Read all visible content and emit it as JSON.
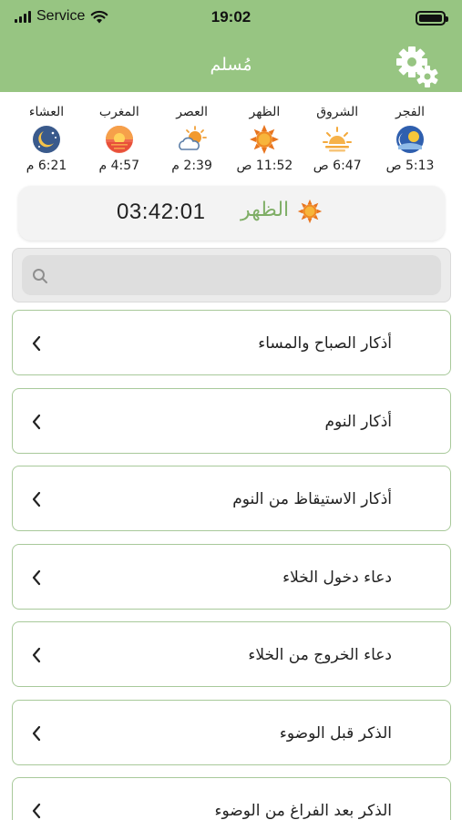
{
  "status_bar": {
    "carrier": "Service",
    "time": "19:02"
  },
  "header": {
    "title": "مُسلم",
    "settings_icon": "gear-icon",
    "background_color": "#97c582"
  },
  "prayers": [
    {
      "name": "الفجر",
      "time": "5:13 ص",
      "icon": "moon-sun-icon"
    },
    {
      "name": "الشروق",
      "time": "6:47 ص",
      "icon": "sunrise-icon"
    },
    {
      "name": "الظهر",
      "time": "11:52 ص",
      "icon": "sun-icon"
    },
    {
      "name": "العصر",
      "time": "2:39 م",
      "icon": "sun-cloud-icon"
    },
    {
      "name": "المغرب",
      "time": "4:57 م",
      "icon": "sunset-icon"
    },
    {
      "name": "العشاء",
      "time": "6:21 م",
      "icon": "moon-night-icon"
    }
  ],
  "next_prayer": {
    "name": "الظهر",
    "countdown": "03:42:01",
    "icon": "sun-icon",
    "accent_color": "#7fae66"
  },
  "search": {
    "placeholder": "",
    "value": ""
  },
  "list": {
    "items": [
      {
        "label": "أذكار الصباح والمساء"
      },
      {
        "label": "أذكار النوم"
      },
      {
        "label": "أذكار الاستيقاظ من النوم"
      },
      {
        "label": "دعاء دخول الخلاء"
      },
      {
        "label": "دعاء الخروج من الخلاء"
      },
      {
        "label": "الذكر قبل الوضوء"
      },
      {
        "label": "الذكر بعد الفراغ من الوضوء"
      }
    ]
  }
}
